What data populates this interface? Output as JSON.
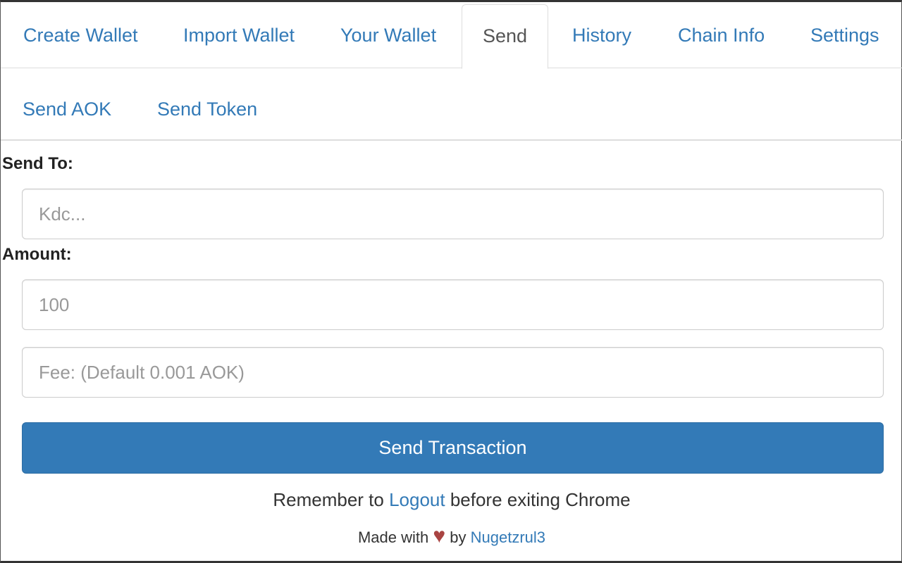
{
  "tabs": [
    {
      "label": "Create Wallet"
    },
    {
      "label": "Import Wallet"
    },
    {
      "label": "Your Wallet"
    },
    {
      "label": "Send",
      "active": true
    },
    {
      "label": "History"
    },
    {
      "label": "Chain Info"
    },
    {
      "label": "Settings"
    }
  ],
  "subtabs": [
    {
      "label": "Send AOK"
    },
    {
      "label": "Send Token"
    }
  ],
  "form": {
    "send_to_label": "Send To:",
    "send_to_placeholder": "Kdc...",
    "amount_label": "Amount:",
    "amount_placeholder": "100",
    "fee_placeholder": "Fee: (Default 0.001 AOK)",
    "submit_label": "Send Transaction"
  },
  "footer": {
    "remember_prefix": "Remember to ",
    "logout_link": "Logout",
    "remember_suffix": " before exiting Chrome",
    "made_with": "Made with ",
    "heart": "♥",
    "by": " by ",
    "author_link": "Nugetzrul3"
  },
  "colors": {
    "accent": "#337ab7",
    "heart": "#a94442"
  }
}
